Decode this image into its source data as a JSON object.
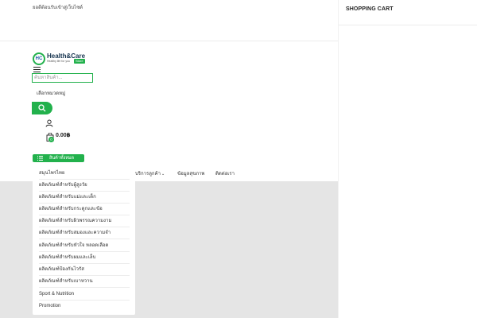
{
  "header": {
    "welcome_text": "ยอดีต้อนรับเข้าสู่เว็บไซต์"
  },
  "logo": {
    "mark": "HC",
    "name": "Health&Care",
    "tagline": "Healthy life for you",
    "badge": "Store"
  },
  "search": {
    "placeholder": "ค้นหาสินค้า...",
    "category_label": "เลือกหมวดหมู่"
  },
  "cart": {
    "count": "0",
    "total": "0.00฿",
    "panel_title": "SHOPPING CART"
  },
  "all_products_button": "สินค้าทั้งหมด",
  "nav": {
    "items": [
      {
        "label": "บริการลูกค้า",
        "has_dropdown": true
      },
      {
        "label": "ข้อมูลสุขภาพ",
        "has_dropdown": false
      },
      {
        "label": "ติดต่อเรา",
        "has_dropdown": false
      }
    ],
    "dropdown_indicator": "⌄"
  },
  "categories": [
    "สมุนไพรไทย",
    "ผลิตภัณฑ์สำหรับผู้สูงวัย",
    "ผลิตภัณฑ์สำหรับแม่และเด็ก",
    "ผลิตภัณฑ์สำหรับกระดูกและข้อ",
    "ผลิตภัณฑ์สำหรับผิวพรรณความงาม",
    "ผลิตภัณฑ์สำหรับสมองและความจำ",
    "ผลิตภัณฑ์สำหรับหัวใจ หลอดเลือด",
    "ผลิตภัณฑ์สำหรับผมและเล็บ",
    "ผลิตภัณฑ์ป้องกันไวรัส",
    "ผลิตภัณฑ์สำหรับเบาหวาน",
    "Sport & Nutrition",
    "Promotion"
  ],
  "colors": {
    "brand_green": "#22b14c",
    "brand_navy": "#16344f",
    "backdrop": "#e5e5e5"
  },
  "icons": {
    "menu": "hamburger-icon",
    "search": "search-icon",
    "user": "user-icon",
    "cart": "shopping-bag-icon",
    "list": "list-icon"
  }
}
